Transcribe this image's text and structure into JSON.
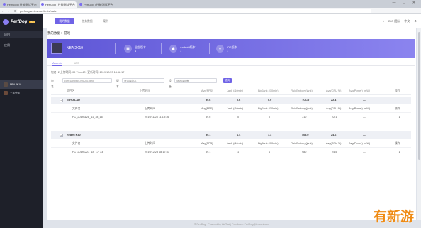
{
  "browser": {
    "tabs": [
      {
        "label": "PerfDog | 性能测试平台",
        "active": false
      },
      {
        "label": "PerfDog | 性能测试平台",
        "active": true
      },
      {
        "label": "PerfDog | 性能测试平台",
        "active": false
      }
    ],
    "url": "perfdog.wetest.net/tests/data",
    "controls": "— ☐ ✕"
  },
  "sidebar": {
    "brand": "PerfDog",
    "brand_badge": "PRO",
    "section_title": "项目",
    "section_sub": "应用",
    "apps": [
      {
        "label": "NBA 2K19",
        "selected": true
      },
      {
        "label": "王者荣耀",
        "selected": false
      }
    ]
  },
  "topbar": {
    "buttons": [
      "我的数据",
      "任务数据",
      "案例"
    ],
    "user": "DIO 团队",
    "lang": "中文"
  },
  "breadcrumb": "我的数据 > 游戏",
  "hero": {
    "game_title": "NBA 2K19",
    "stats": [
      {
        "icon": "monitor-icon",
        "label": "全部版本",
        "value": "1"
      },
      {
        "icon": "android-icon",
        "label": "Android版本",
        "value": "1"
      },
      {
        "icon": "apple-icon",
        "label": "iOS版本",
        "value": "1"
      }
    ]
  },
  "subtabs": [
    "Android",
    "iOS"
  ],
  "info": "包名: 2   上传时间: 09 T4m 47s   更新时间: 2019/12/23 14:58:17",
  "filters": {
    "package_label": "包名",
    "package_value": "com.t2kspecs.nba2k19and",
    "version_label": "版本",
    "version_placeholder": "请选择版本",
    "device_label": "设备",
    "device_placeholder": "请选择设备",
    "search_label": "查询"
  },
  "table": {
    "headers": [
      "文件名",
      "上传时间",
      "Avg(FPS)",
      "Jank (/10min)",
      "BigJank (/10min)",
      "FluidEntropy(jank)",
      "Avg(CPU %)",
      "Avg(Power) (mW)",
      "操作"
    ],
    "groups": [
      {
        "name": "TRY ALAD",
        "summary": [
          "59.6",
          "0.6",
          "0.0",
          "TOLD",
          "22.4",
          "—"
        ],
        "rows": [
          {
            "file": "PC_20191128_11_18_16",
            "time": "2019/11/28 11:18:16",
            "values": [
              "59.6",
              "0",
              "0",
              "710",
              "22.1",
              "—"
            ]
          }
        ]
      },
      {
        "name": "Redmi K30",
        "summary": [
          "59.1",
          "1.4",
          "1.3",
          "408.0",
          "24.6",
          "—"
        ],
        "rows": [
          {
            "file": "PC_20191223_18_17_33",
            "time": "2019/12/23 18:17:33",
            "values": [
              "59.1",
              "1",
              "1",
              "980",
              "24.5",
              "—"
            ]
          }
        ]
      }
    ]
  },
  "footer": "© PerfDog · Powered by WeTest  |  Feedback: PerfDog@tencent.com",
  "watermark": "有新游",
  "colors": {
    "accent": "#6f63e6",
    "sidebar": "#1e2029",
    "hero_start": "#5e56d6",
    "hero_end": "#8b84ef",
    "watermark": "#ef8a12"
  }
}
